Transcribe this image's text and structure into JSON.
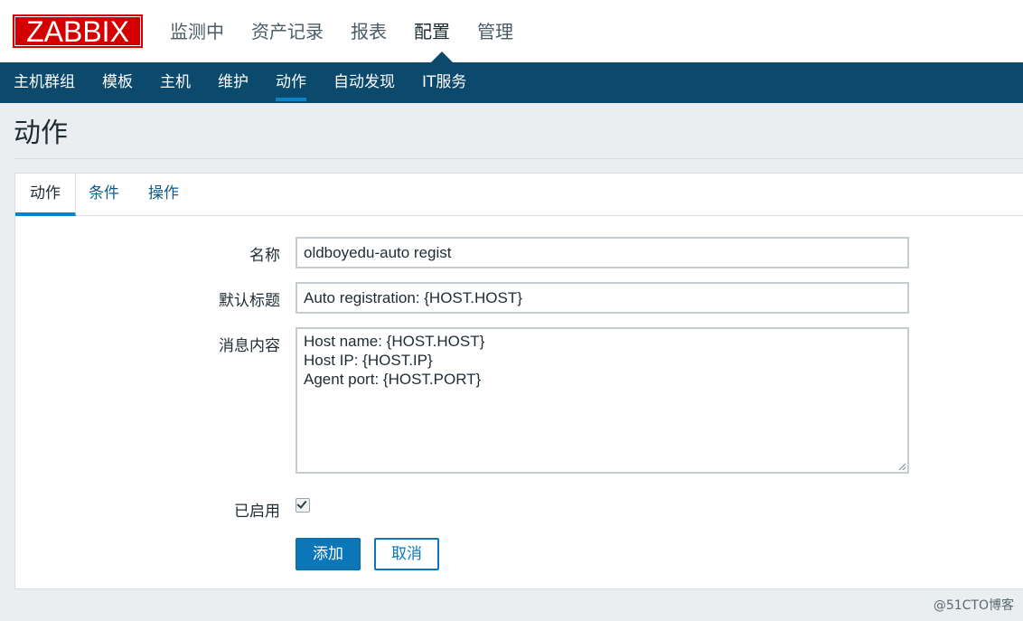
{
  "logo": {
    "text": "ZABBIX"
  },
  "main_nav": [
    "监测中",
    "资产记录",
    "报表",
    "配置",
    "管理"
  ],
  "main_nav_active": "配置",
  "sub_nav": [
    "主机群组",
    "模板",
    "主机",
    "维护",
    "动作",
    "自动发现",
    "IT服务"
  ],
  "sub_nav_active": "动作",
  "page": {
    "title": "动作"
  },
  "tabs": [
    "动作",
    "条件",
    "操作"
  ],
  "form": {
    "name_label": "名称",
    "name_value": "oldboyedu-auto regist",
    "subject_label": "默认标题",
    "subject_value": "Auto registration: {HOST.HOST}",
    "message_label": "消息内容",
    "message_value": "Host name: {HOST.HOST}\nHost IP: {HOST.IP}\nAgent port: {HOST.PORT}",
    "enabled_label": "已启用",
    "enabled": true,
    "add_button": "添加",
    "cancel_button": "取消"
  },
  "watermark": "@51CTO博客",
  "colors": {
    "brand_red": "#d40000",
    "subnav_bg": "#0b496d",
    "accent_blue": "#0b76b8"
  }
}
